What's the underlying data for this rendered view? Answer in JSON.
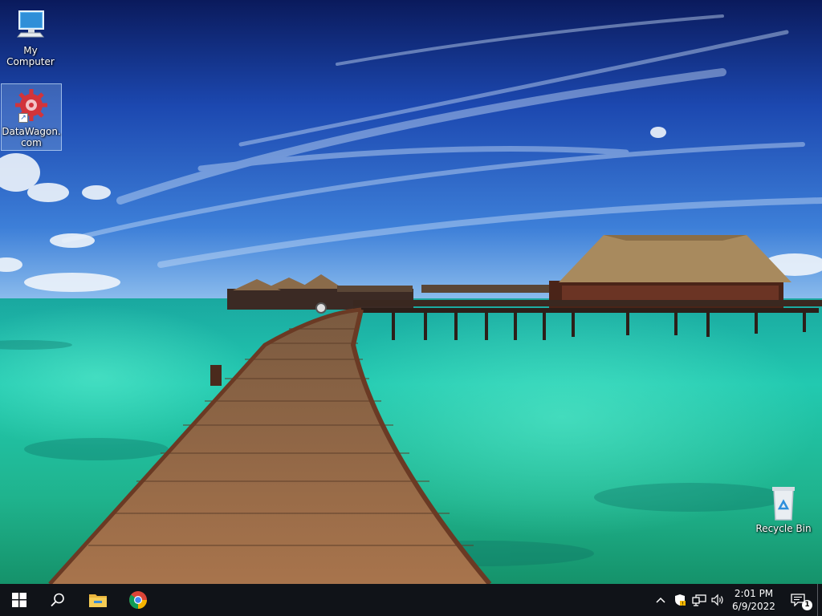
{
  "desktop": {
    "icons": [
      {
        "label": "My Computer",
        "icon": "computer-monitor-icon"
      },
      {
        "label": "DataWagon.com",
        "icon": "datawagon-gear-icon",
        "shortcut": true,
        "selected": true
      },
      {
        "label": "Recycle Bin",
        "icon": "recycle-bin-icon"
      }
    ]
  },
  "taskbar": {
    "start": "windows-start-icon",
    "search": "search-icon",
    "pinned": [
      "file-explorer-icon",
      "chrome-icon"
    ],
    "tray": {
      "chevron": "show-hidden-icons-chevron",
      "icons": [
        "security-shield-icon",
        "network-icon",
        "volume-icon"
      ],
      "time": "2:01 PM",
      "date": "6/9/2022",
      "notification_count": "1"
    }
  },
  "colors": {
    "taskbar": "#101318",
    "sky_top": "#0b1f66",
    "sky_mid": "#2a66c8",
    "water": "#2fd4b3"
  }
}
